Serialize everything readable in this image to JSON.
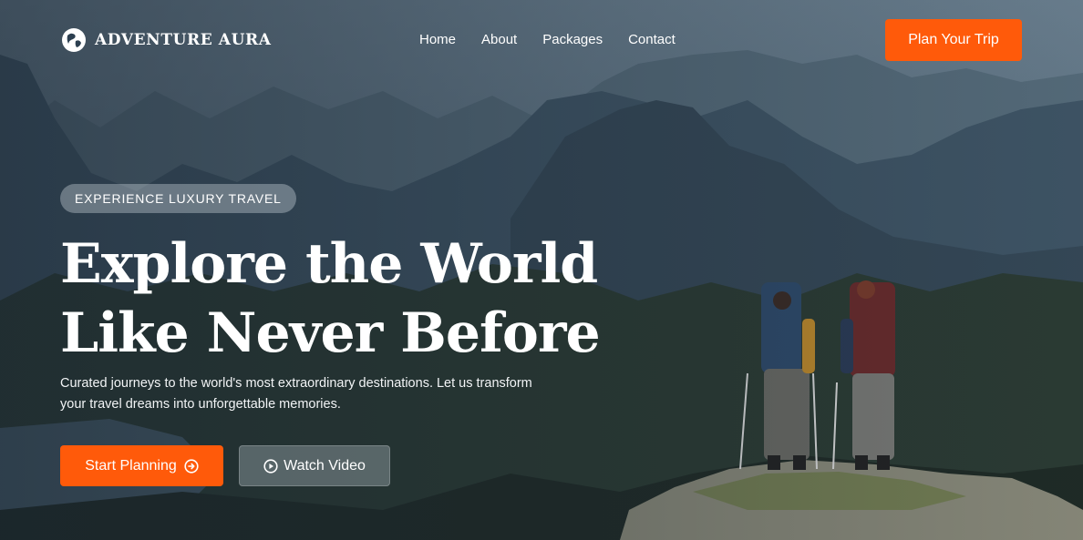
{
  "brand": {
    "name": "ADVENTURE AURA",
    "logo_icon": "globe-leaf-icon"
  },
  "nav": {
    "links": [
      {
        "label": "Home"
      },
      {
        "label": "About"
      },
      {
        "label": "Packages"
      },
      {
        "label": "Contact"
      }
    ],
    "cta_label": "Plan Your Trip"
  },
  "hero": {
    "badge": "EXPERIENCE LUXURY TRAVEL",
    "headline_line1": "Explore the World",
    "headline_line2": "Like Never Before",
    "subtext": "Curated journeys to the world's most extraordinary destinations. Let us transform your travel dreams into unforgettable memories.",
    "primary_button": {
      "label": "Start Planning",
      "icon": "arrow-right-circle-icon"
    },
    "secondary_button": {
      "label": "Watch Video",
      "icon": "play-circle-icon"
    }
  },
  "colors": {
    "accent": "#ff5a0a",
    "text": "#ffffff"
  }
}
